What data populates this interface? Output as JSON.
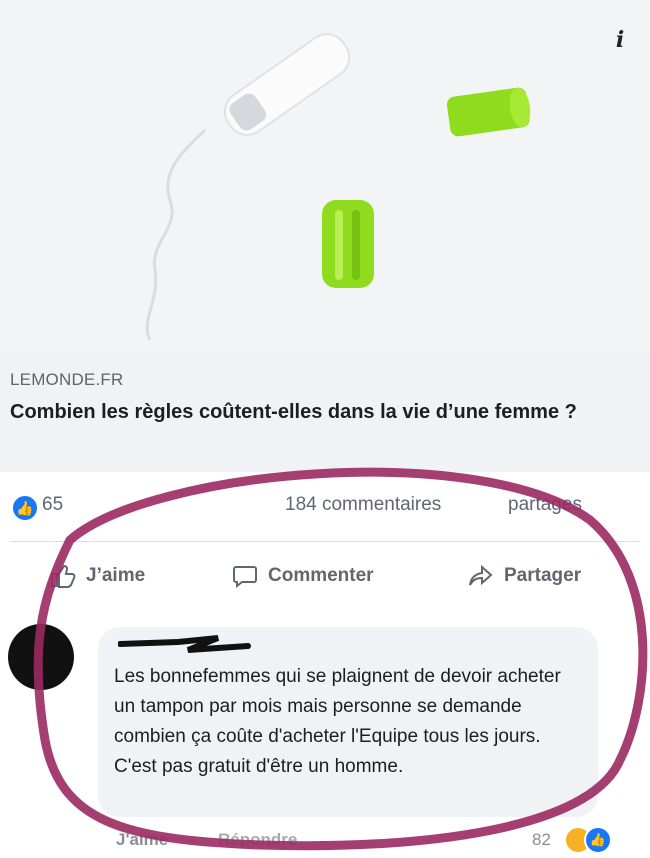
{
  "post": {
    "image_alt_icons": [
      "tampon-icon",
      "applicator-cap-icon",
      "applicator-tube-icon"
    ],
    "info_icon": "i",
    "link": {
      "source": "LEMONDE.FR",
      "headline": "Combien les règles coûtent-elles dans la vie d’une femme ?"
    },
    "stats": {
      "likes": "65",
      "comments": "184 commentaires",
      "shares": "partages"
    },
    "actions": {
      "like": "J’aime",
      "comment": "Commenter",
      "share": "Partager"
    }
  },
  "comment": {
    "text": "Les bonnefemmes qui se plaignent de devoir acheter un tampon par mois mais personne se demande combien ça coûte d'acheter l'Equipe tous les jours. C'est pas gratuit d'être un homme.",
    "footer": {
      "like": "J'aime",
      "reply": "Répondre",
      "reaction_count": "82"
    }
  },
  "colors": {
    "facebook_blue": "#1877f2",
    "highlight_circle": "#9b2a63",
    "applicator_green": "#8fdc1e"
  }
}
